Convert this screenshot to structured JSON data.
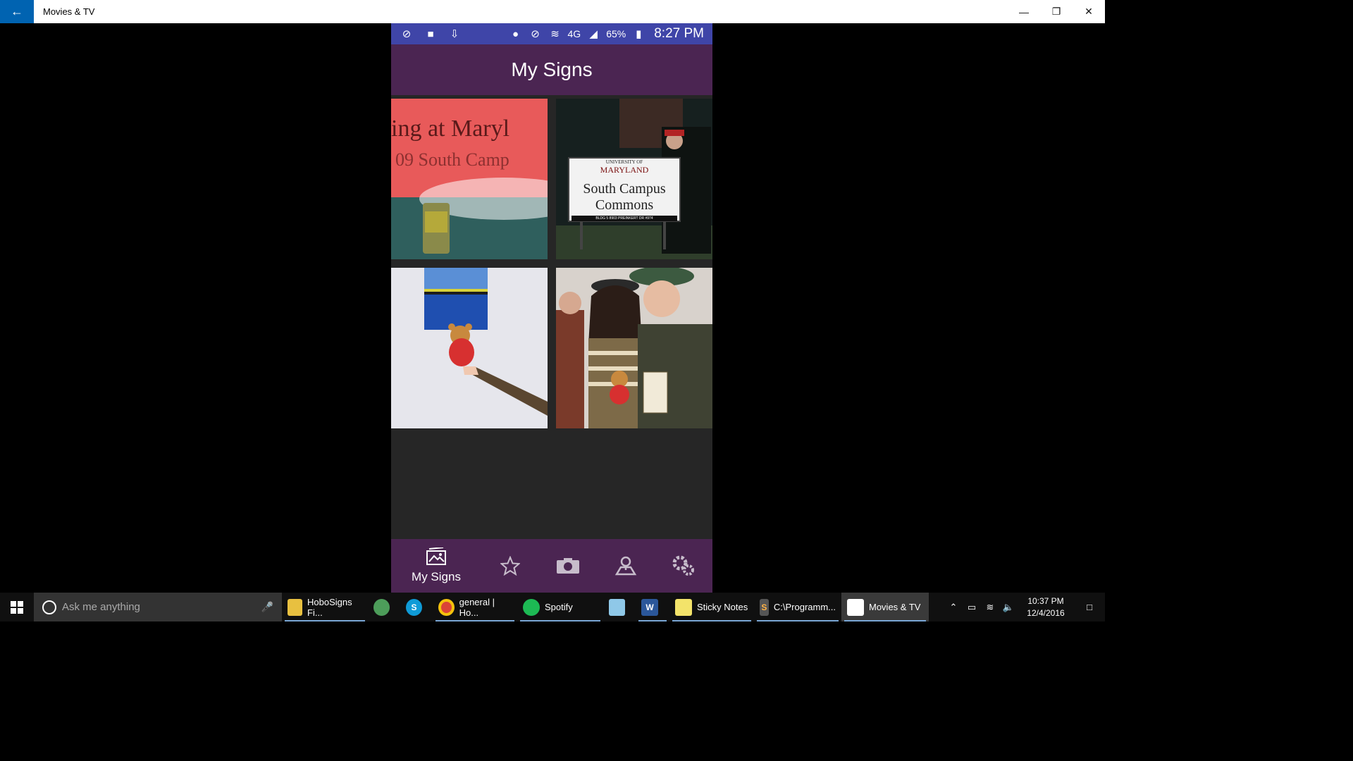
{
  "window": {
    "title": "Movies & TV",
    "back_icon": "back-arrow-icon",
    "controls": {
      "minimize": "—",
      "restore": "❐",
      "close": "✕"
    }
  },
  "phone": {
    "status": {
      "battery": "65%",
      "network": "4G",
      "time": "8:27 PM"
    },
    "app_title": "My Signs",
    "photos": [
      {
        "desc_text": "ing at Maryl",
        "sub_text": "09 South Camp"
      },
      {
        "sign_top": "UNIVERSITY OF",
        "sign_brand": "MARYLAND",
        "sign_line1": "South Campus",
        "sign_line2": "Commons",
        "sign_small": "BLDG 5   8903 PREINKERT DR   #974"
      },
      {},
      {}
    ],
    "nav": [
      {
        "label": "My Signs",
        "icon": "gallery-icon"
      },
      {
        "icon": "star-icon"
      },
      {
        "icon": "camera-icon"
      },
      {
        "icon": "map-pin-icon"
      },
      {
        "icon": "settings-icon"
      }
    ]
  },
  "taskbar": {
    "search_placeholder": "Ask me anything",
    "apps": [
      {
        "label": "HoboSigns Fi..."
      },
      {
        "label": ""
      },
      {
        "label": ""
      },
      {
        "label": "general | Ho..."
      },
      {
        "label": "Spotify"
      },
      {
        "label": ""
      },
      {
        "label": ""
      },
      {
        "label": "Sticky Notes"
      },
      {
        "label": "C:\\Programm..."
      },
      {
        "label": "Movies & TV"
      }
    ],
    "clock_time": "10:37 PM",
    "clock_date": "12/4/2016"
  },
  "colors": {
    "accent": "#0063b1",
    "app_purple": "#4b2552",
    "status_blue": "#3f45a8"
  }
}
